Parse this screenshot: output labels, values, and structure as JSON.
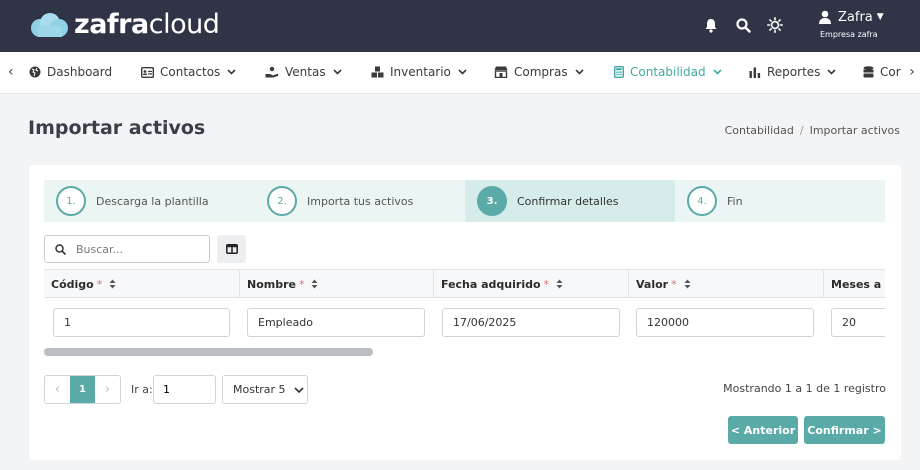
{
  "brand": {
    "bold": "zafra",
    "light": "cloud"
  },
  "user": {
    "name": "Zafra",
    "company": "Empresa zafra"
  },
  "nav": {
    "items": [
      {
        "label": "Dashboard"
      },
      {
        "label": "Contactos"
      },
      {
        "label": "Ventas"
      },
      {
        "label": "Inventario"
      },
      {
        "label": "Compras"
      },
      {
        "label": "Contabilidad"
      },
      {
        "label": "Reportes"
      },
      {
        "label": "Cor"
      }
    ]
  },
  "page": {
    "title": "Importar activos",
    "breadcrumb": [
      "Contabilidad",
      "/",
      "Importar activos"
    ]
  },
  "steps": [
    {
      "num": "1.",
      "label": "Descarga la plantilla"
    },
    {
      "num": "2.",
      "label": "Importa tus activos"
    },
    {
      "num": "3.",
      "label": "Confirmar detalles"
    },
    {
      "num": "4.",
      "label": "Fin"
    }
  ],
  "search": {
    "placeholder": "Buscar..."
  },
  "table": {
    "columns": [
      {
        "label": "Código",
        "required": "*"
      },
      {
        "label": "Nombre",
        "required": "*"
      },
      {
        "label": "Fecha adquirido",
        "required": "*"
      },
      {
        "label": "Valor",
        "required": "*"
      },
      {
        "label": "Meses a de",
        "required": ""
      }
    ],
    "row": [
      "1",
      "Empleado",
      "17/06/2025",
      "120000",
      "20"
    ]
  },
  "pagination": {
    "current": "1",
    "goto_label": "Ir a:",
    "goto_value": "1",
    "show": "Mostrar 5",
    "records": "Mostrando 1 a 1 de 1 registro"
  },
  "buttons": {
    "prev": "< Anterior",
    "next": "Confirmar >"
  },
  "colors": {
    "topbar": "#2f3447",
    "accent": "#5aaaa8",
    "required": "#e07070"
  }
}
